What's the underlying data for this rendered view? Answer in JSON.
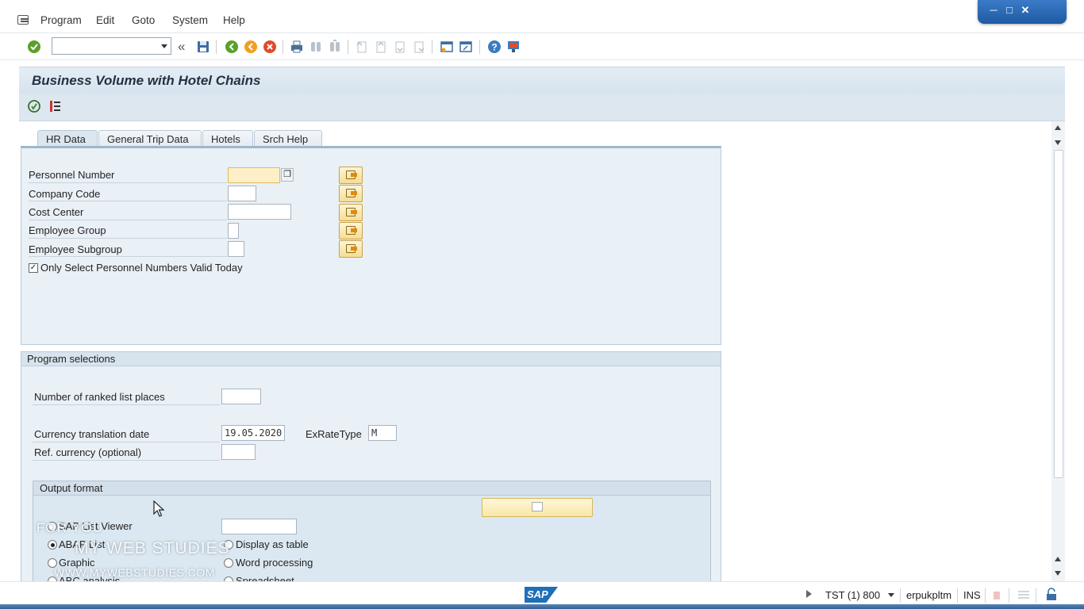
{
  "menubar": {
    "items": [
      {
        "label": "Program",
        "hotkey": "P"
      },
      {
        "label": "Edit",
        "hotkey": "E"
      },
      {
        "label": "Goto",
        "hotkey": "G"
      },
      {
        "label": "System",
        "hotkey": "S"
      },
      {
        "label": "Help",
        "hotkey": "H"
      }
    ]
  },
  "toolbar": {
    "command_value": "",
    "icons": [
      "enter-icon",
      "command-field",
      "collapse-icon",
      "save-icon",
      "back-icon",
      "exit-icon",
      "cancel-icon",
      "print-icon",
      "find-icon",
      "find-next-icon",
      "first-page-icon",
      "previous-page-icon",
      "next-page-icon",
      "last-page-icon",
      "new-session-icon",
      "shortcut-icon",
      "help-icon",
      "customize-layout-icon"
    ]
  },
  "screen": {
    "title": "Business Volume with Hotel Chains",
    "app_toolbar_icons": [
      "execute-icon",
      "selection-options-icon"
    ]
  },
  "tabs": [
    {
      "label": "HR Data",
      "active": true
    },
    {
      "label": "General Trip Data",
      "active": false
    },
    {
      "label": "Hotels",
      "active": false
    },
    {
      "label": "Srch Help",
      "active": false
    }
  ],
  "hr_data": {
    "fields": [
      {
        "label": "Personnel Number",
        "value": ""
      },
      {
        "label": "Company Code",
        "value": ""
      },
      {
        "label": "Cost Center",
        "value": ""
      },
      {
        "label": "Employee Group",
        "value": ""
      },
      {
        "label": "Employee Subgroup",
        "value": ""
      }
    ],
    "checkbox_label": "Only Select Personnel Numbers Valid Today",
    "checkbox_checked": true
  },
  "program_selections": {
    "header": "Program selections",
    "ranked_list_label": "Number of ranked list places",
    "ranked_list_value": "",
    "currency_date_label": "Currency translation date",
    "currency_date_value": "19.05.2020",
    "exrate_label": "ExRateType",
    "exrate_value": "M",
    "ref_currency_label": "Ref. currency (optional)",
    "ref_currency_value": ""
  },
  "output_format": {
    "header": "Output format",
    "options": [
      {
        "label": "SAP List Viewer",
        "selected": false
      },
      {
        "label": "ABAP List",
        "selected": true
      },
      {
        "label": "Display as table",
        "selected": false
      },
      {
        "label": "Graphic",
        "selected": false
      },
      {
        "label": "Word processing",
        "selected": false
      },
      {
        "label": "ABC analysis",
        "selected": false
      },
      {
        "label": "Spreadsheet",
        "selected": false
      }
    ],
    "layout_value": ""
  },
  "watermark": {
    "line1": "FOR YOU",
    "line2": "MY WEB STUDIES",
    "line3": "WWW.MYWEBSTUDIES.COM"
  },
  "statusbar": {
    "sap_logo": "SAP",
    "system": "TST (1) 800",
    "server": "erpukpltm",
    "mode": "INS"
  },
  "colors": {
    "title_bg": "#dbe6ef",
    "panel_bg": "#e9f0f6",
    "required_field": "#fdf0c8",
    "sap_blue": "#1f6fb8"
  }
}
